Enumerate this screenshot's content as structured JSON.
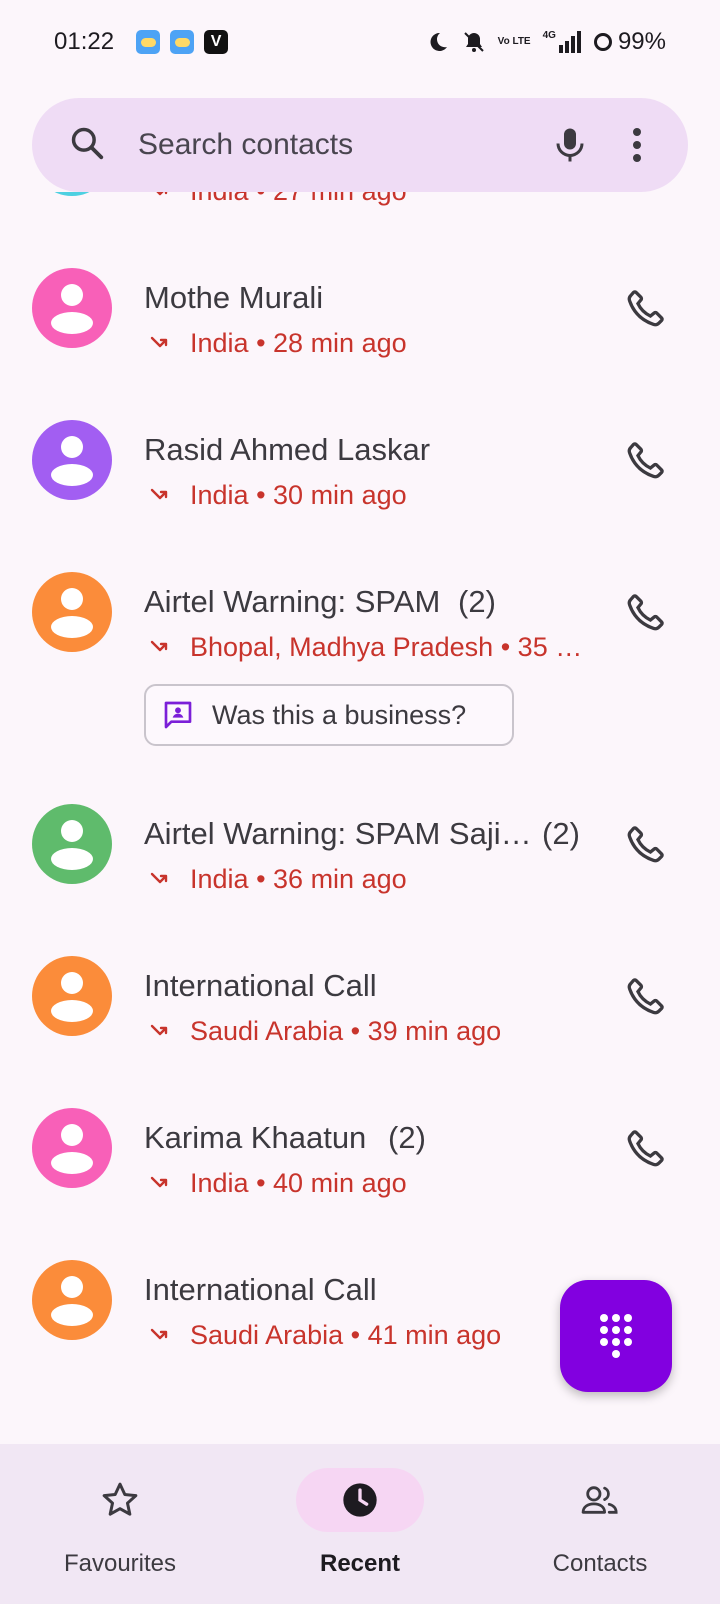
{
  "status_bar": {
    "time": "01:22",
    "battery": "99%",
    "network": "4G",
    "volte": "Vo LTE",
    "notification_icons": [
      "weather-icon",
      "weather-icon",
      "vivaldi-icon"
    ],
    "status_icons": [
      "moon-icon",
      "bell-off-icon",
      "volte-icon",
      "signal-icon",
      "battery-icon"
    ]
  },
  "search": {
    "placeholder": "Search contacts",
    "icons": [
      "search-icon",
      "mic-icon",
      "more-vert-icon"
    ]
  },
  "calls": [
    {
      "name": "",
      "count": "",
      "location": "India",
      "time": "27 min ago",
      "avatar_color": "#4dd0e1",
      "call_type": "missed"
    },
    {
      "name": "Mothe Murali",
      "count": "",
      "location": "India",
      "time": "28 min ago",
      "avatar_color": "#f860b8",
      "call_type": "missed"
    },
    {
      "name": "Rasid Ahmed Laskar",
      "count": "",
      "location": "India",
      "time": "30 min ago",
      "avatar_color": "#a25ef2",
      "call_type": "missed"
    },
    {
      "name": "Airtel Warning: SPAM",
      "count": "(2)",
      "location": "Bhopal, Madhya Pradesh",
      "time": "35 …",
      "avatar_color": "#fb8c3a",
      "call_type": "missed",
      "chip": "Was this a business?"
    },
    {
      "name": "Airtel Warning: SPAM Saji…",
      "count": "(2)",
      "location": "India",
      "time": "36 min ago",
      "avatar_color": "#5fbb6c",
      "call_type": "missed"
    },
    {
      "name": "International Call",
      "count": "",
      "location": "Saudi Arabia",
      "time": "39 min ago",
      "avatar_color": "#fb8c3a",
      "call_type": "missed"
    },
    {
      "name": "Karima Khaatun",
      "count": "(2)",
      "location": "India",
      "time": "40 min ago",
      "avatar_color": "#f860b8",
      "call_type": "missed"
    },
    {
      "name": "International Call",
      "count": "",
      "location": "Saudi Arabia",
      "time": "41 min ago",
      "avatar_color": "#fb8c3a",
      "call_type": "missed"
    }
  ],
  "fab": {
    "icon": "dialpad-icon",
    "color": "#8200e0"
  },
  "bottom_nav": {
    "items": [
      {
        "label": "Favourites",
        "icon": "star-icon",
        "active": false
      },
      {
        "label": "Recent",
        "icon": "clock-icon",
        "active": true
      },
      {
        "label": "Contacts",
        "icon": "people-icon",
        "active": false
      }
    ]
  },
  "colors": {
    "background": "#fcf6fb",
    "search_bg": "#efdcf5",
    "missed_call": "#c8342c",
    "nav_bg": "#f1e7f4",
    "active_pill": "#f6d6f3"
  }
}
